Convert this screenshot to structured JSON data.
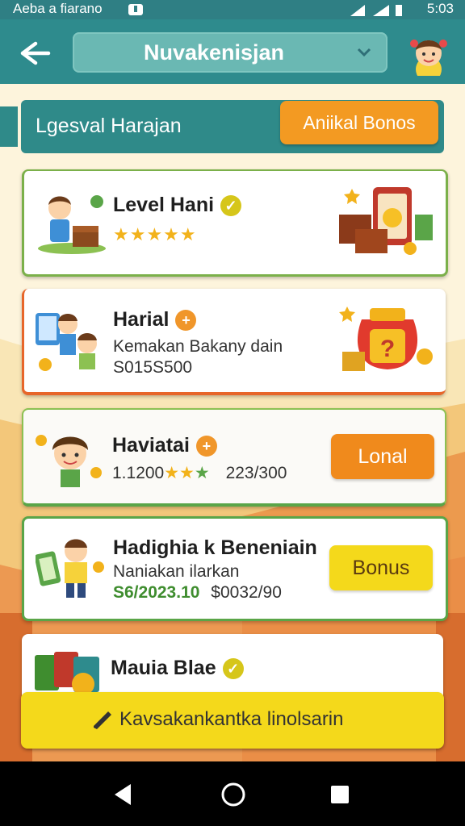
{
  "status_bar": {
    "left_text": "Aeba a fiarano",
    "time": "5:03"
  },
  "top_bar": {
    "title": "Nuvakenisjan"
  },
  "section": {
    "label": "Lgesval Harajan",
    "button_label": "Aniikal Bonos"
  },
  "items": [
    {
      "name": "Level Hani",
      "stars": 5
    },
    {
      "name": "Harial",
      "line1": "Kemakan Bakany dain",
      "line2": "S015S500"
    },
    {
      "name": "Haviatai",
      "value_left": "1.1200",
      "value_right": "223/300",
      "button_label": "Lonal"
    },
    {
      "name": "Hadighia k Beneniain",
      "line1": "Naniakan ilarkan",
      "value_green": "S6/2023.10",
      "value_dark": "$0032/90",
      "button_label": "Bonus"
    },
    {
      "name": "Mauia Blae"
    }
  ],
  "bottom_button": {
    "label": "Kavsakankantka linolsarin"
  },
  "colors": {
    "teal": "#2e8b8d",
    "orange": "#f39a22",
    "yellow": "#f4d91b",
    "green": "#6aa83a"
  }
}
